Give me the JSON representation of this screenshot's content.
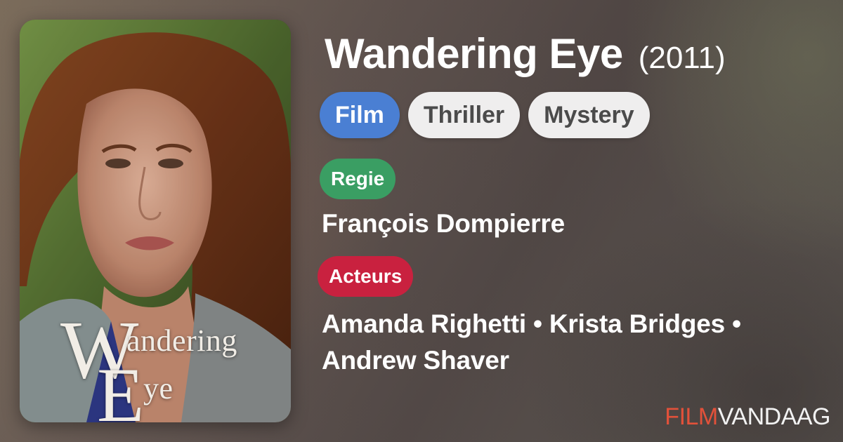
{
  "movie": {
    "title": "Wandering Eye",
    "year": "(2011)"
  },
  "tags": [
    {
      "label": "Film",
      "variant": "primary"
    },
    {
      "label": "Thriller",
      "variant": "secondary"
    },
    {
      "label": "Mystery",
      "variant": "secondary"
    }
  ],
  "poster": {
    "title_text": "Wandering Eye"
  },
  "credits": {
    "regie_label": "Regie",
    "director": "François Dompierre",
    "acteurs_label": "Acteurs",
    "cast_line1": "Amanda Righetti • Krista Bridges •",
    "cast_line2": "Andrew Shaver"
  },
  "brand": {
    "part1": "FILM",
    "part2": "VANDAAG"
  },
  "colors": {
    "film_tag": "#4a7fd3",
    "regie_pill": "#3a9e63",
    "acteurs_pill": "#c9213f",
    "brand_accent": "#e2513a"
  },
  "icons": []
}
